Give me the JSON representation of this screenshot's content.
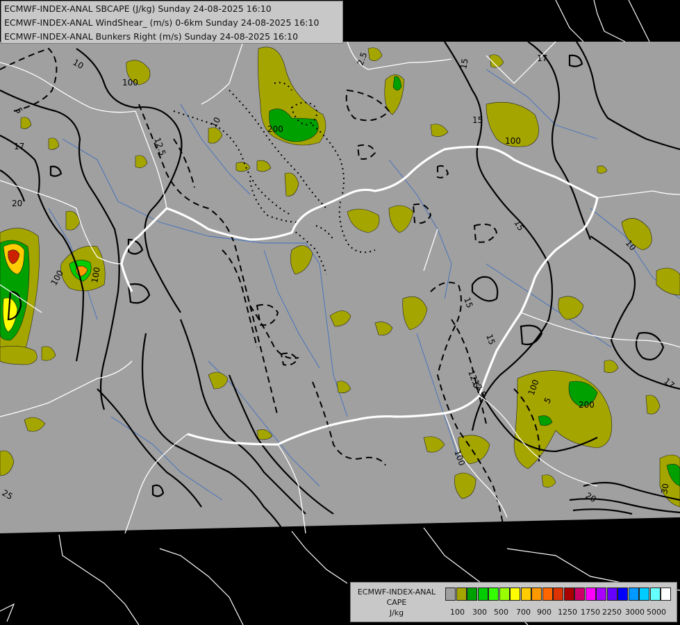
{
  "titles": {
    "line1": "ECMWF-INDEX-ANAL SBCAPE (J/kg) Sunday 24-08-2025 16:10",
    "line2": "ECMWF-INDEX-ANAL WindShear_ (m/s) 0-6km Sunday 24-08-2025 16:10",
    "line3": "ECMWF-INDEX-ANAL Bunkers Right (m/s) Sunday 24-08-2025 16:10"
  },
  "legend": {
    "line1": "ECMWF-INDEX-ANAL",
    "line2": "CAPE",
    "line3": "J/kg",
    "colors": [
      "#a0a0a0",
      "#a5a500",
      "#00a000",
      "#00cc00",
      "#33ff00",
      "#99ff00",
      "#ffff00",
      "#ffcc00",
      "#ff9900",
      "#ff6600",
      "#dd3300",
      "#aa0000",
      "#cc0066",
      "#ff00ff",
      "#aa00ff",
      "#6600ff",
      "#0000ff",
      "#0099ff",
      "#00ccff",
      "#66ffff",
      "#ffffff"
    ],
    "ticks": [
      "100",
      "300",
      "500",
      "700",
      "900",
      "1250",
      "1750",
      "2250",
      "3000",
      "5000"
    ]
  },
  "contour_labels": [
    "10",
    "100",
    "2.5",
    "15",
    "17",
    "12.5",
    "10",
    "200",
    "15",
    "100",
    "20",
    "17",
    "100",
    "5",
    "15",
    "12.5",
    "15",
    "15",
    "12.5",
    "100",
    "100",
    "200",
    "10",
    "17",
    "20",
    "25",
    "30",
    "5",
    "100"
  ],
  "colors": {
    "domain_grey": "#a0a0a0",
    "outside": "#000000",
    "cape_low": "#a5a500",
    "cape_green": "#00a000",
    "border": "#ffffff",
    "river": "#3f6fbf"
  }
}
